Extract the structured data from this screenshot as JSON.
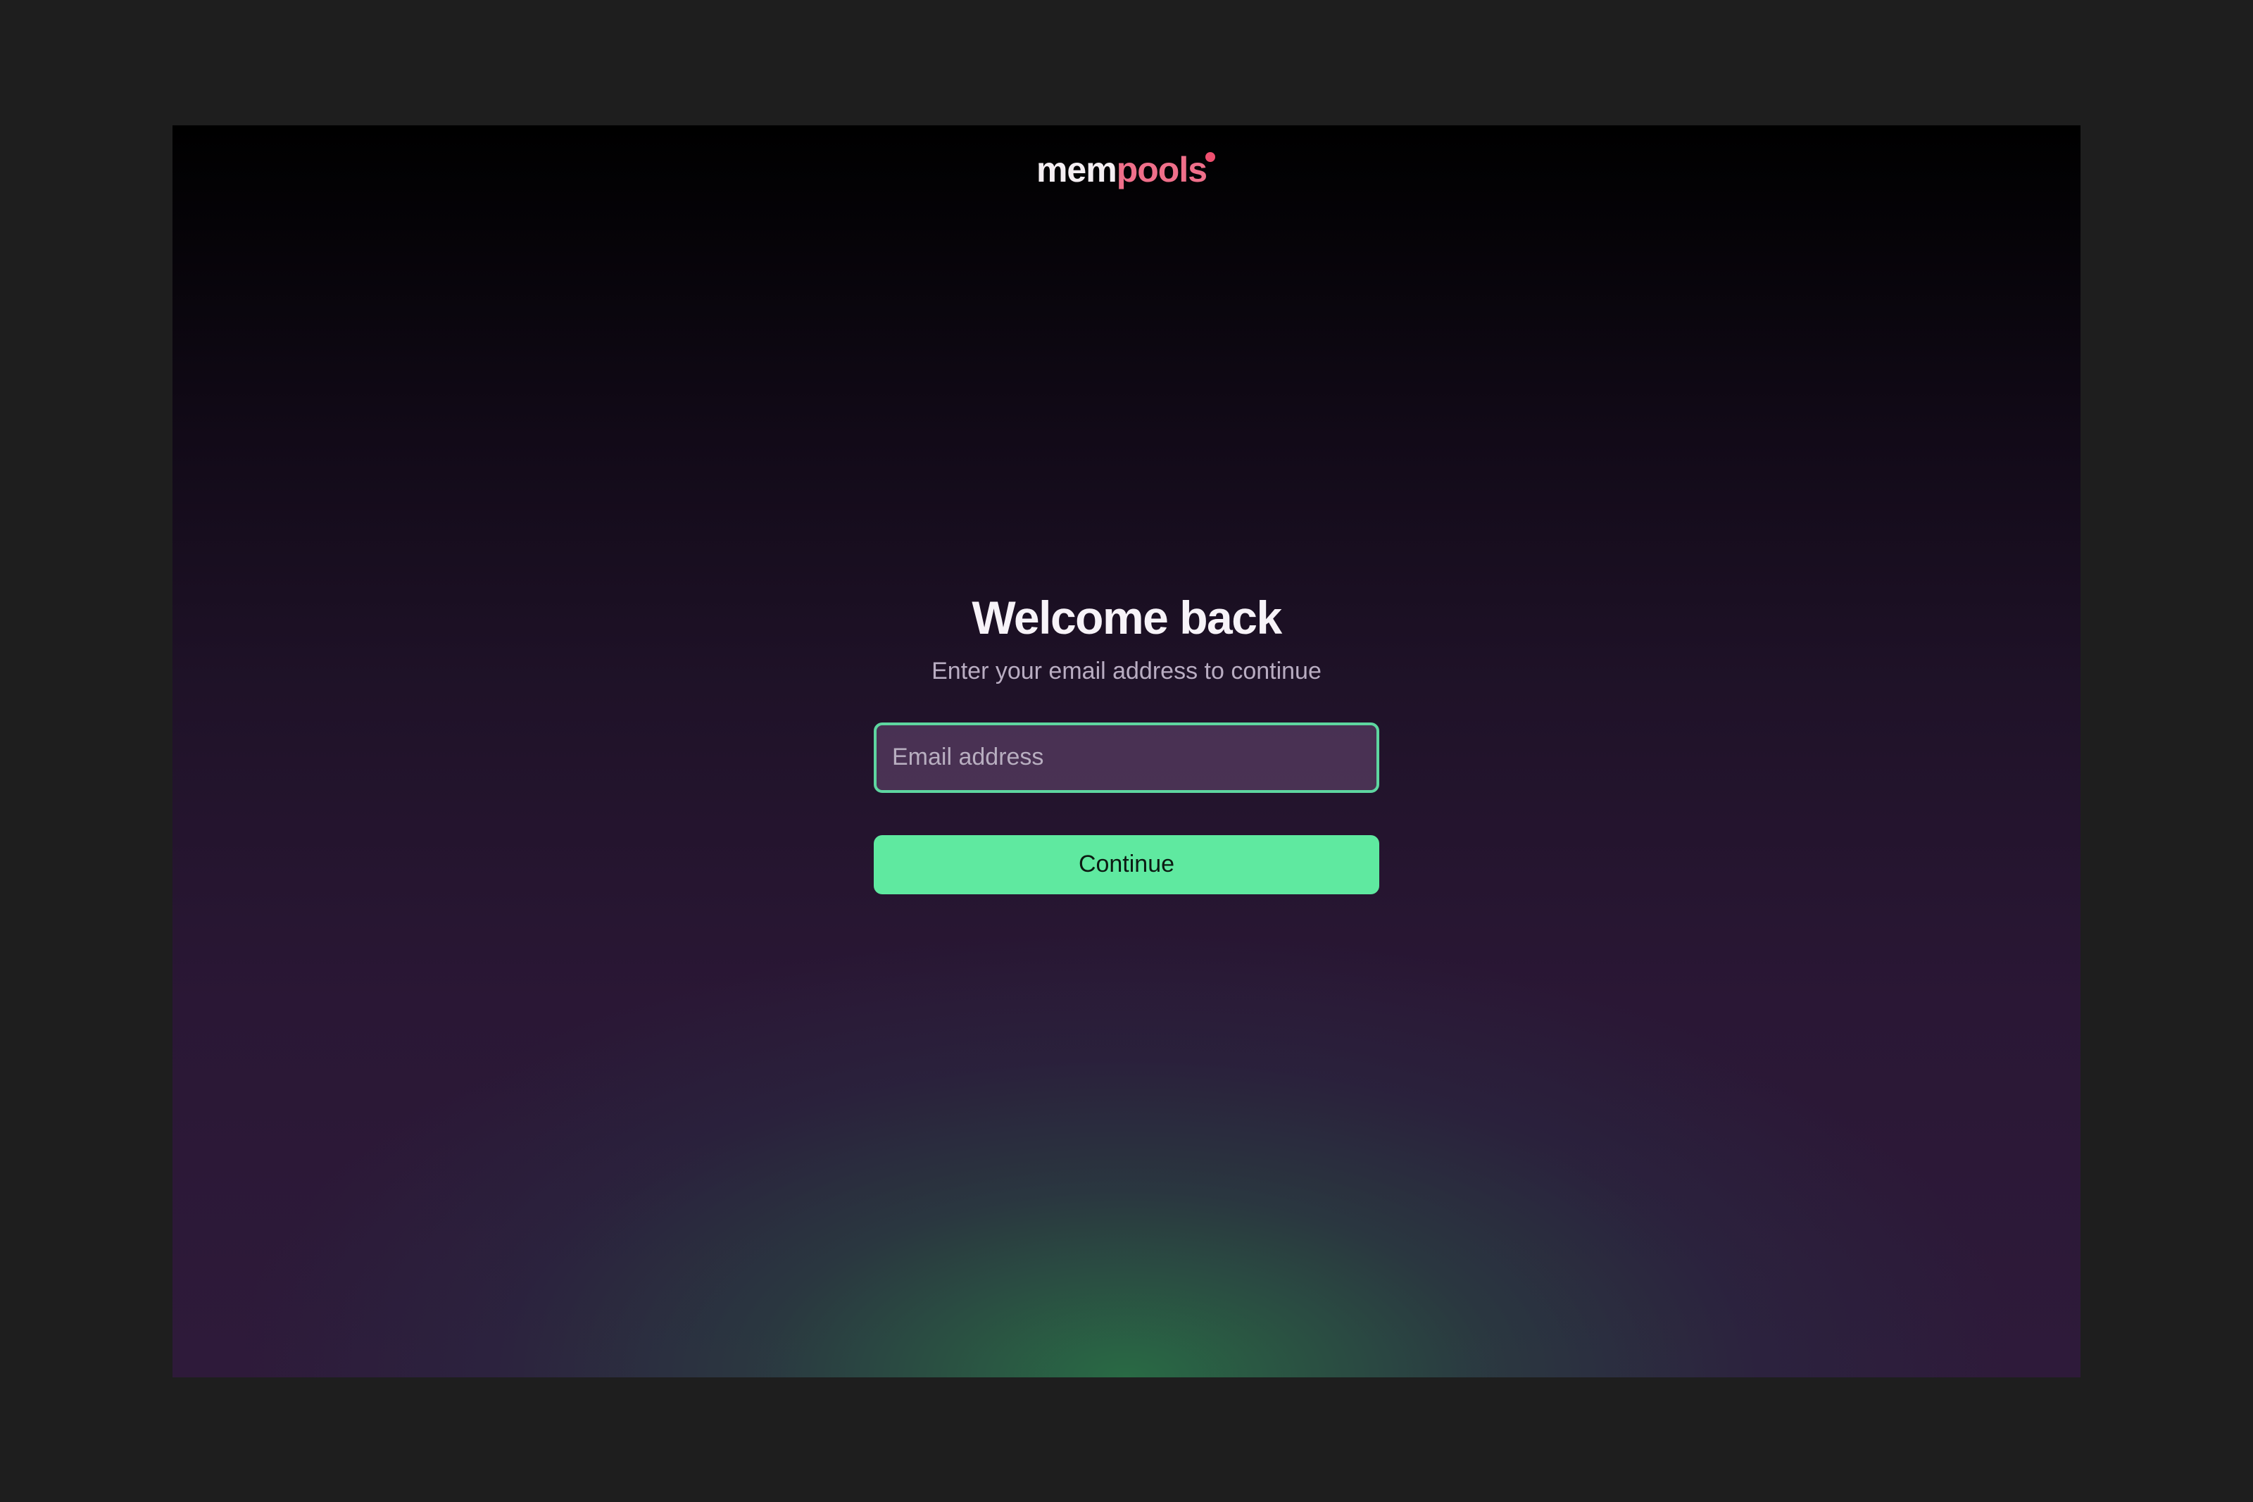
{
  "brand": {
    "logo_part1": "mem",
    "logo_part2": "pools",
    "accent_color": "#ef6f8a"
  },
  "login": {
    "title": "Welcome back",
    "subtitle": "Enter your email address to continue",
    "email_placeholder": "Email address",
    "email_value": "",
    "continue_label": "Continue"
  },
  "colors": {
    "button": "#5fe9a0",
    "input_focus_border": "#5ed6a0",
    "outer_background": "#1e1e1e"
  }
}
